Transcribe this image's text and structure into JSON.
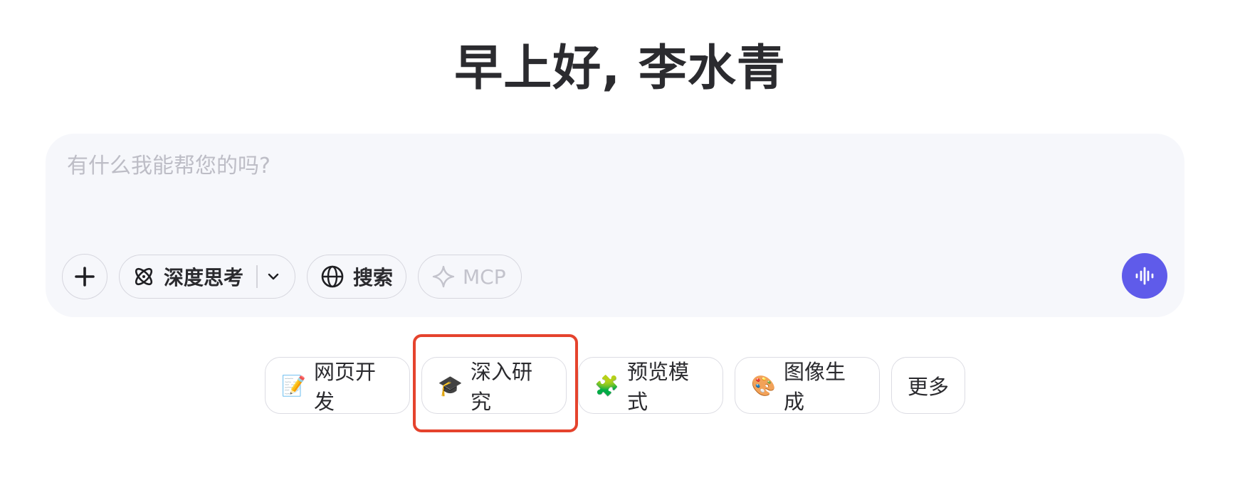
{
  "greeting": "早上好, 李水青",
  "composer": {
    "placeholder": "有什么我能帮您的吗?",
    "value": ""
  },
  "toolbar": {
    "add": {
      "icon": "plus-icon"
    },
    "deep_think": {
      "label": "深度思考",
      "icon": "atom-icon",
      "dropdown_icon": "chevron-down-icon"
    },
    "search": {
      "label": "搜索",
      "icon": "globe-icon"
    },
    "mcp": {
      "label": "MCP",
      "icon": "sparkle-icon"
    },
    "voice": {
      "icon": "audio-wave-icon"
    }
  },
  "quick_actions": [
    {
      "emoji": "📝",
      "label": "网页开发"
    },
    {
      "emoji": "🎓",
      "label": "深入研究"
    },
    {
      "emoji": "🧩",
      "label": "预览模式"
    },
    {
      "emoji": "🎨",
      "label": "图像生成"
    },
    {
      "label": "更多"
    }
  ],
  "colors": {
    "accent": "#5f5bea",
    "composer_bg": "#f6f7fb",
    "highlight": "#e5432d",
    "placeholder": "#bdbdc6",
    "disabled_text": "#c3c3cc"
  }
}
